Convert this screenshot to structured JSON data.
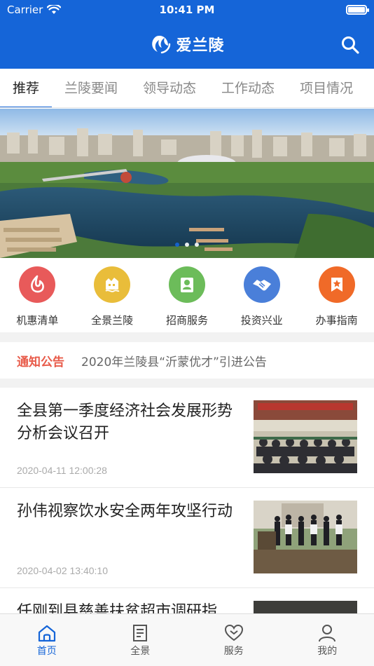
{
  "status_bar": {
    "carrier": "Carrier",
    "time": "10:41 PM"
  },
  "nav": {
    "title": "爱兰陵"
  },
  "tabs": [
    {
      "label": "推荐",
      "active": true
    },
    {
      "label": "兰陵要闻"
    },
    {
      "label": "领导动态"
    },
    {
      "label": "工作动态"
    },
    {
      "label": "项目情况"
    }
  ],
  "banner": {
    "dots": 3,
    "active_dot": 0
  },
  "services": [
    {
      "label": "机惠清单",
      "color": "#e85a5a",
      "icon": "flame-icon"
    },
    {
      "label": "全景兰陵",
      "color": "#e9bd3a",
      "icon": "landscape-icon"
    },
    {
      "label": "招商服务",
      "color": "#6cbc5a",
      "icon": "person-card-icon"
    },
    {
      "label": "投资兴业",
      "color": "#4a7fd9",
      "icon": "handshake-icon"
    },
    {
      "label": "办事指南",
      "color": "#f06a28",
      "icon": "bookmark-star-icon"
    }
  ],
  "notice": {
    "tag": "通知公告",
    "text": "2020年兰陵县“沂蒙优才”引进公告"
  },
  "news": [
    {
      "title": "全县第一季度经济社会发展形势分析会议召开",
      "date": "2020-04-11 12:00:28",
      "thumb": "meeting"
    },
    {
      "title": "孙伟视察饮水安全两年攻坚行动",
      "date": "2020-04-02 13:40:10",
      "thumb": "inspection"
    },
    {
      "title": "任刚到县慈善扶贫超市调研指",
      "date": "",
      "thumb": "store"
    }
  ],
  "tabbar": [
    {
      "label": "首页",
      "icon": "home-icon",
      "active": true
    },
    {
      "label": "全景",
      "icon": "document-icon"
    },
    {
      "label": "服务",
      "icon": "heart-icon"
    },
    {
      "label": "我的",
      "icon": "user-icon"
    }
  ],
  "colors": {
    "primary": "#1565d8",
    "notice_tag": "#e85b4a"
  }
}
